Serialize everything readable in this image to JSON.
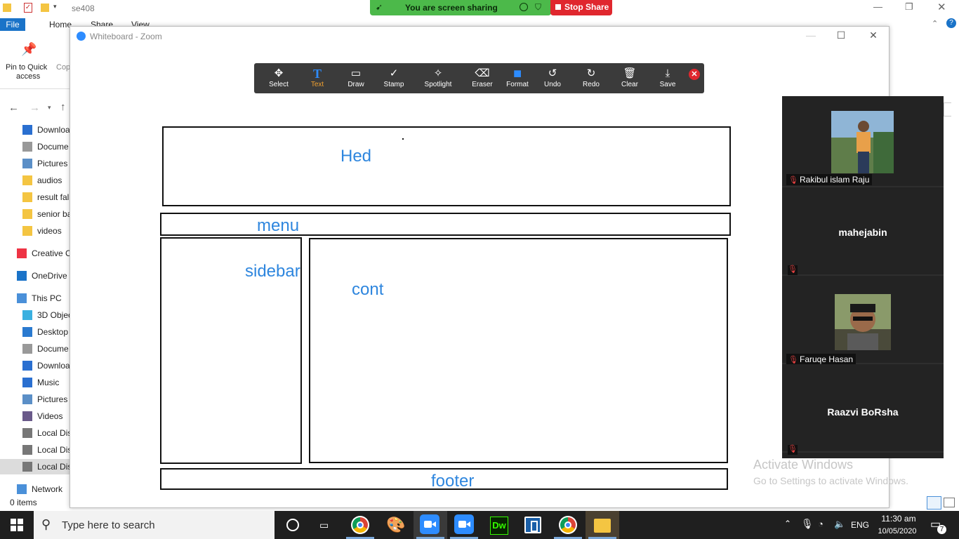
{
  "explorer": {
    "title": "se408",
    "tabs": {
      "file": "File",
      "home": "Home",
      "share": "Share",
      "view": "View"
    },
    "ribbon": {
      "pin_label_line1": "Pin to Quick",
      "pin_label_line2": "access",
      "copy_label": "Cop"
    },
    "nav_items": [
      {
        "label": "Downloa",
        "icon": "download-icon"
      },
      {
        "label": "Docume",
        "icon": "document-icon"
      },
      {
        "label": "Pictures",
        "icon": "pictures-icon"
      },
      {
        "label": "audios",
        "icon": "folder-icon"
      },
      {
        "label": "result fal",
        "icon": "folder-icon"
      },
      {
        "label": "senior ba",
        "icon": "folder-icon"
      },
      {
        "label": "videos",
        "icon": "folder-icon"
      },
      {
        "label": "Creative C",
        "icon": "creative-cloud-icon"
      },
      {
        "label": "OneDrive",
        "icon": "onedrive-icon"
      },
      {
        "label": "This PC",
        "icon": "this-pc-icon"
      },
      {
        "label": "3D Objec",
        "icon": "3d-objects-icon"
      },
      {
        "label": "Desktop",
        "icon": "desktop-icon"
      },
      {
        "label": "Docume",
        "icon": "document-icon"
      },
      {
        "label": "Downloa",
        "icon": "download-icon"
      },
      {
        "label": "Music",
        "icon": "music-icon"
      },
      {
        "label": "Pictures",
        "icon": "pictures-icon"
      },
      {
        "label": "Videos",
        "icon": "videos-icon"
      },
      {
        "label": "Local Dis",
        "icon": "drive-icon"
      },
      {
        "label": "Local Dis",
        "icon": "drive-icon"
      },
      {
        "label": "Local Dis",
        "icon": "drive-icon"
      },
      {
        "label": "Network",
        "icon": "network-icon"
      }
    ],
    "status": "0 items"
  },
  "sharing": {
    "message": "You are screen sharing",
    "stop_label": "Stop Share"
  },
  "whiteboard": {
    "window_title": "Whiteboard - Zoom",
    "tools": [
      {
        "label": "Select",
        "icon": "move-icon"
      },
      {
        "label": "Text",
        "icon": "text-icon",
        "active": true
      },
      {
        "label": "Draw",
        "icon": "rectangle-icon"
      },
      {
        "label": "Stamp",
        "icon": "checkmark-icon"
      },
      {
        "label": "Spotlight",
        "icon": "wand-icon"
      },
      {
        "label": "Eraser",
        "icon": "eraser-icon"
      },
      {
        "label": "Format",
        "icon": "format-swatch-icon"
      },
      {
        "label": "Undo",
        "icon": "undo-icon"
      },
      {
        "label": "Redo",
        "icon": "redo-icon"
      },
      {
        "label": "Clear",
        "icon": "trash-icon"
      },
      {
        "label": "Save",
        "icon": "save-icon"
      }
    ],
    "annotations": {
      "header": "Hed",
      "menu": "menu",
      "sidebar": "sidebar",
      "content": "cont",
      "footer": "footer"
    },
    "accent_color": "#2e86de"
  },
  "participants": [
    {
      "name": "Rakibul islam Raju",
      "has_video": true,
      "muted": true
    },
    {
      "name": "mahejabin",
      "has_video": false,
      "muted": true
    },
    {
      "name": "Faruqe Hasan",
      "has_video": true,
      "muted": true
    },
    {
      "name": "Raazvi BoRsha",
      "has_video": false,
      "muted": true
    }
  ],
  "watermark": {
    "title": "Activate Windows",
    "subtitle": "Go to Settings to activate Windows."
  },
  "taskbar": {
    "search_placeholder": "Type here to search",
    "language": "ENG",
    "time": "11:30 am",
    "date": "10/05/2020",
    "notification_count": "7"
  }
}
